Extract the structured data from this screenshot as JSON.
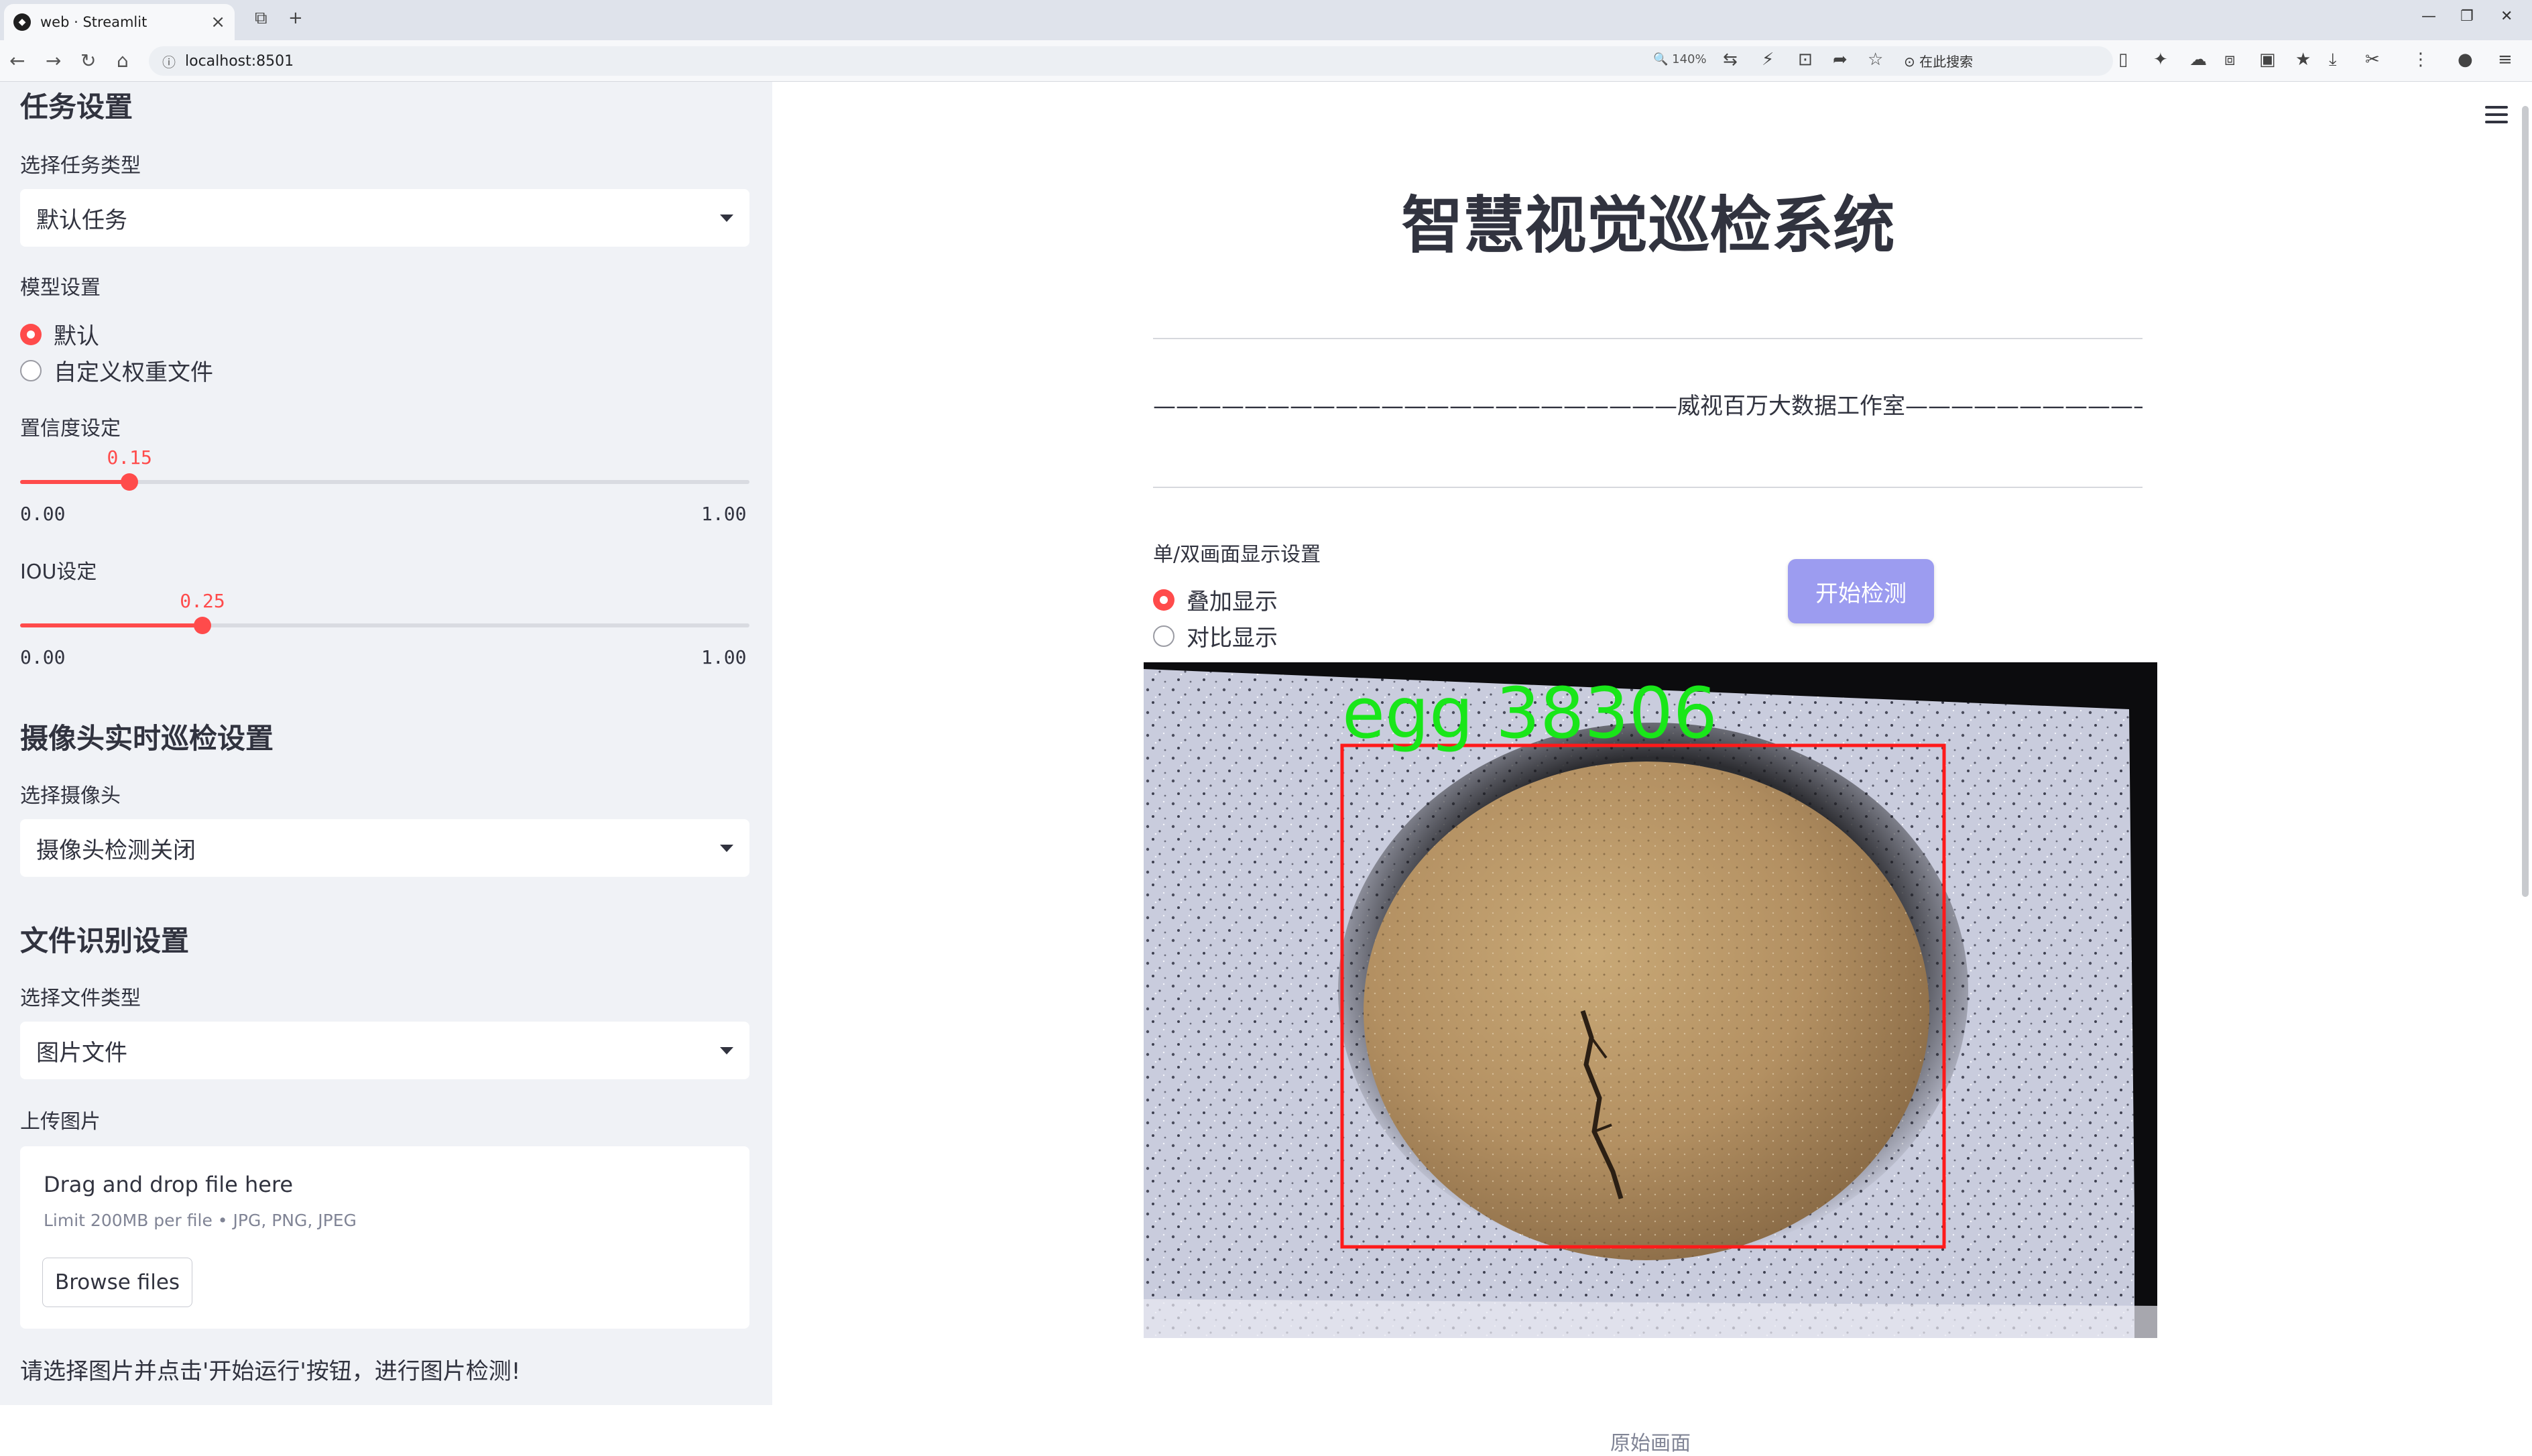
{
  "browser": {
    "tab_title": "web · Streamlit",
    "tab_favicon": "streamlit-icon",
    "url": "localhost:8501",
    "zoom": "140%",
    "search_placeholder": "在此搜索"
  },
  "sidebar": {
    "task_heading": "任务设置",
    "task_type_label": "选择任务类型",
    "task_type_value": "默认任务",
    "model_label": "模型设置",
    "model_options": [
      "默认",
      "自定义权重文件"
    ],
    "model_selected": 0,
    "conf_label": "置信度设定",
    "conf_value": "0.15",
    "conf_fraction": 0.15,
    "conf_min": "0.00",
    "conf_max": "1.00",
    "iou_label": "IOU设定",
    "iou_value": "0.25",
    "iou_fraction": 0.25,
    "iou_min": "0.00",
    "iou_max": "1.00",
    "camera_heading": "摄像头实时巡检设置",
    "camera_label": "选择摄像头",
    "camera_value": "摄像头检测关闭",
    "file_heading": "文件识别设置",
    "file_type_label": "选择文件类型",
    "file_type_value": "图片文件",
    "upload_label": "上传图片",
    "upload_title": "Drag and drop file here",
    "upload_limit": "Limit 200MB per file • JPG, PNG, JPEG",
    "browse_label": "Browse files",
    "note": "请选择图片并点击'开始运行'按钮，进行图片检测!"
  },
  "main": {
    "title": "智慧视觉巡检系统",
    "subtitle": "———————————————————————威视百万大数据工作室————————————————————————",
    "display_label": "单/双画面显示设置",
    "display_options": [
      "叠加显示",
      "对比显示"
    ],
    "display_selected": 0,
    "start_button": "开始检测",
    "detection_label": "egg  38306",
    "caption": "原始画面"
  },
  "colors": {
    "accent": "#ff4b4b",
    "sidebar_bg": "#f0f2f6",
    "button_bg": "#9c9cf0",
    "box_color": "#ff1a1a",
    "label_color": "#19e619"
  }
}
